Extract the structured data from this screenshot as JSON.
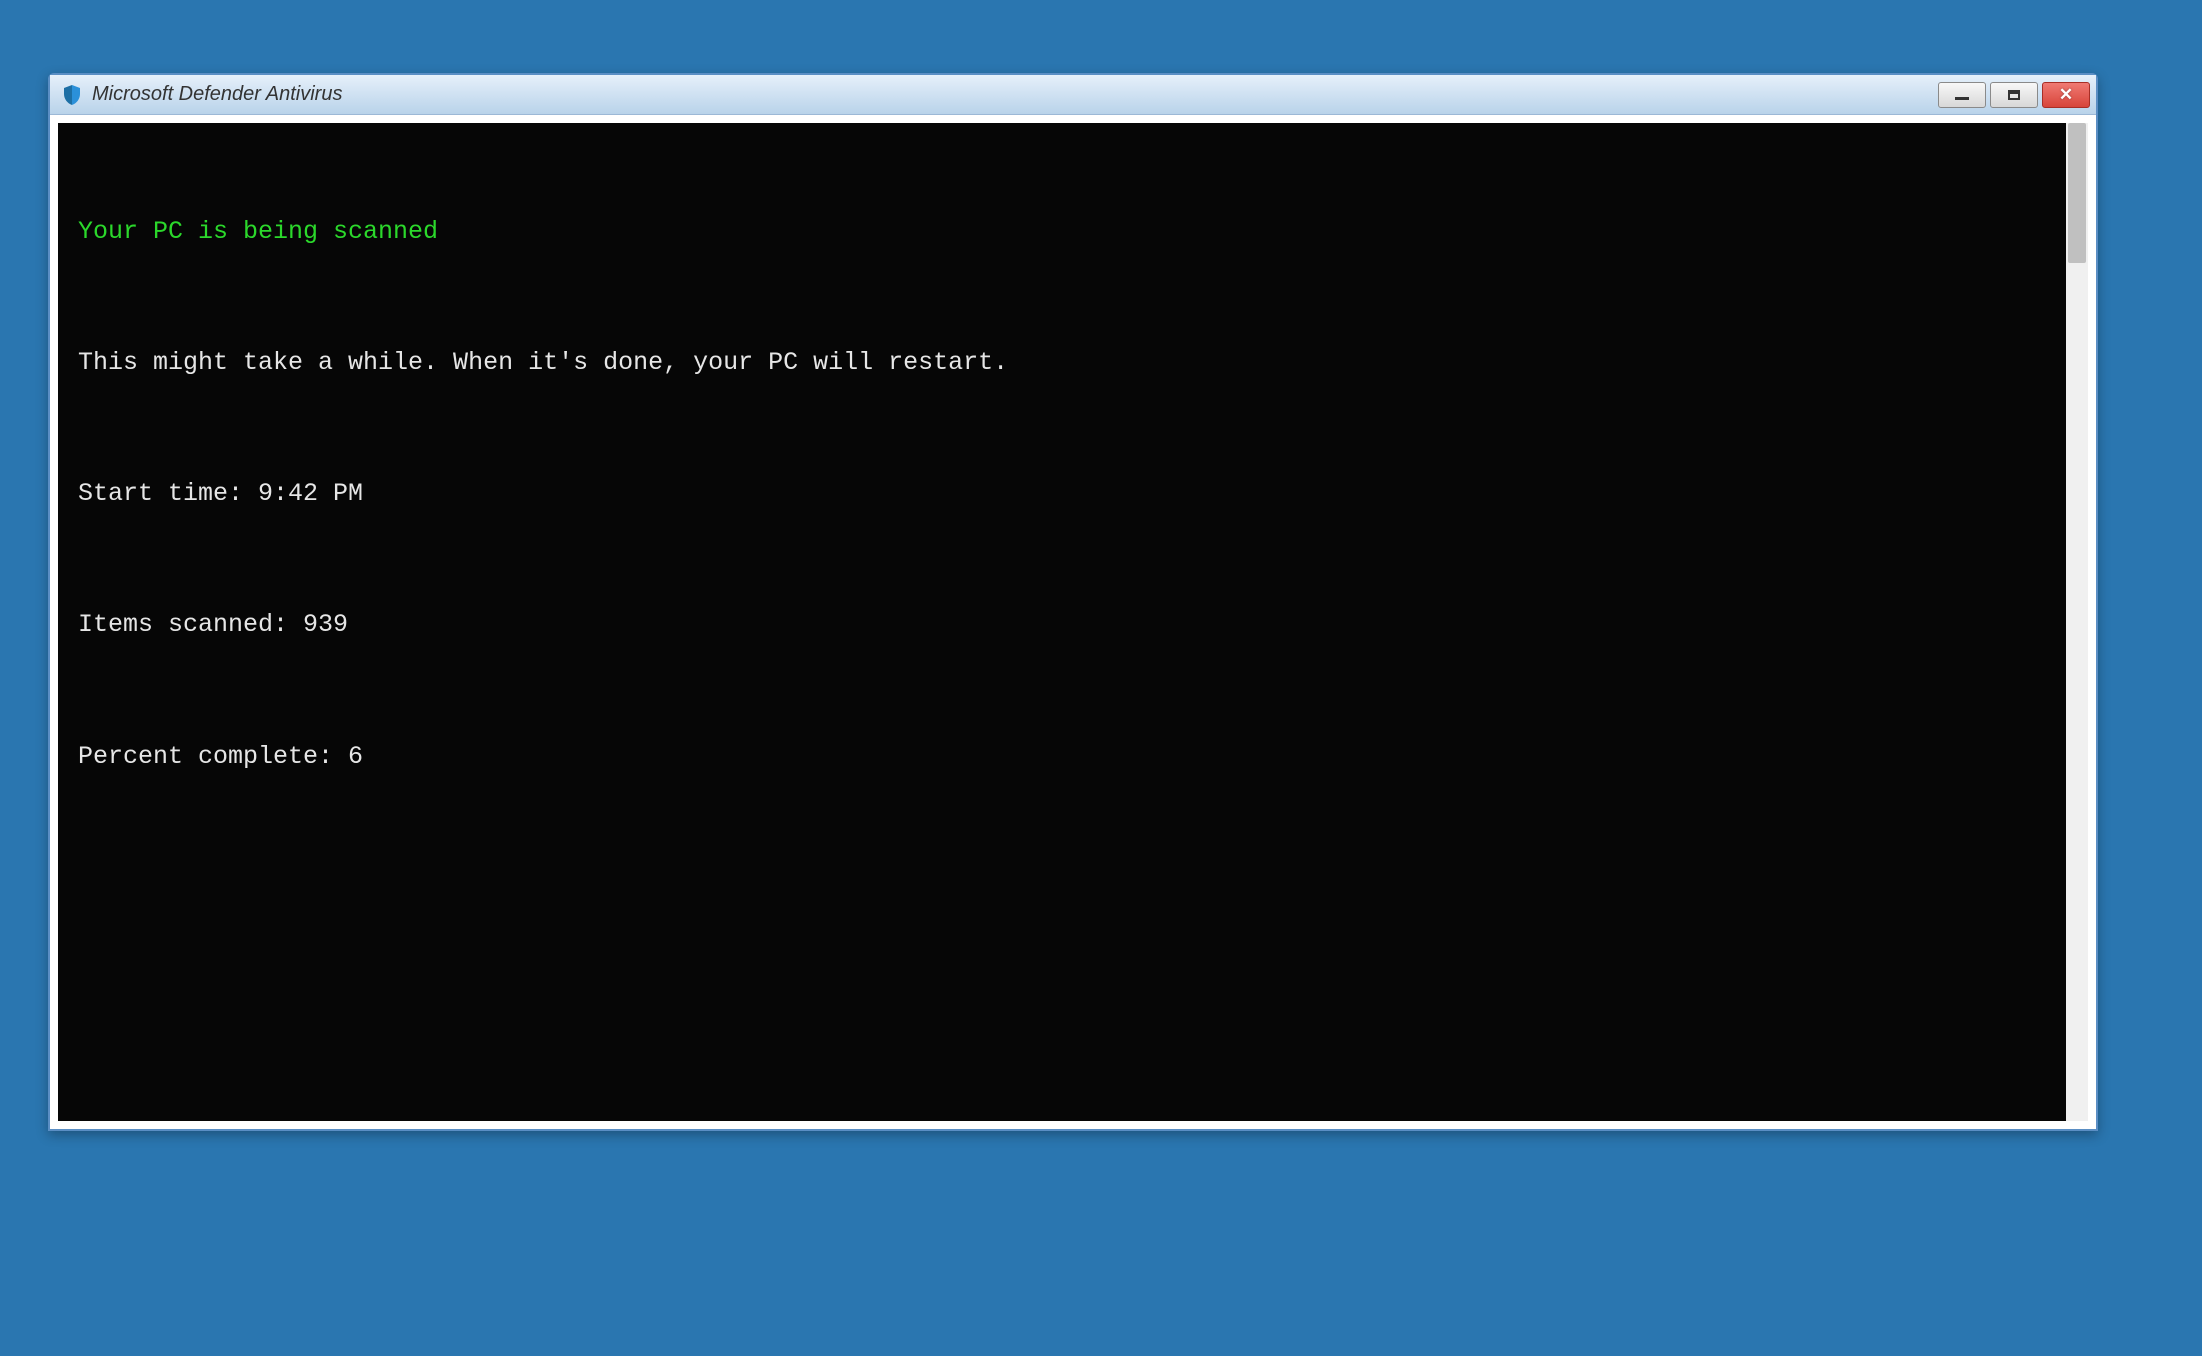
{
  "window": {
    "title": "Microsoft Defender Antivirus"
  },
  "console": {
    "headline": "Your PC is being scanned",
    "message": "This might take a while. When it's done, your PC will restart.",
    "start_time_label": "Start time: ",
    "start_time_value": "9:42 PM",
    "items_scanned_label": "Items scanned: ",
    "items_scanned_value": "939",
    "percent_complete_label": "Percent complete: ",
    "percent_complete_value": "6"
  }
}
